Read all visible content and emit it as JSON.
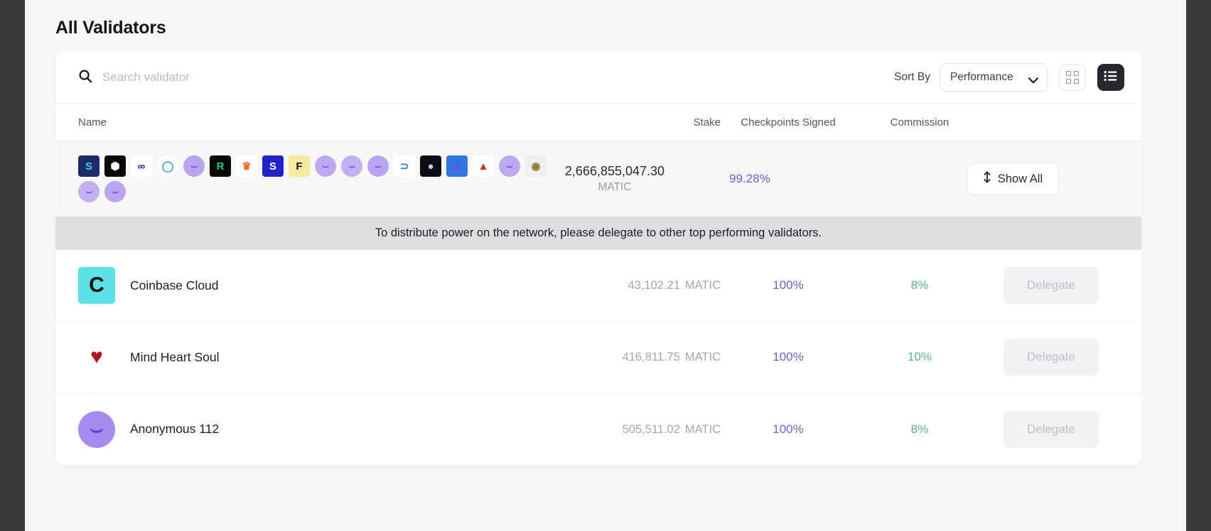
{
  "page": {
    "title": "All Validators"
  },
  "toolbar": {
    "search_placeholder": "Search validator",
    "search_value": "",
    "sort_label": "Sort By",
    "sort_value": "Performance",
    "sort_options": [
      "Performance"
    ],
    "grid_view_label": "Grid view",
    "list_view_label": "List view"
  },
  "table": {
    "headers": {
      "name": "Name",
      "stake": "Stake",
      "checkpoints": "Checkpoints Signed",
      "commission": "Commission"
    }
  },
  "aggregate": {
    "stake": "2,666,855,047.30",
    "stake_unit": "MATIC",
    "checkpoints": "99.28%",
    "show_all_label": "Show All",
    "avatars": [
      {
        "name": "sperax-avatar",
        "bg": "#1d2b6b",
        "fg": "#3fd6e8",
        "glyph": "S"
      },
      {
        "name": "hexagon-avatar",
        "bg": "#0a0a0a",
        "fg": "#ffffff",
        "glyph": "⬢"
      },
      {
        "name": "infinity-avatar",
        "bg": "#ffffff",
        "fg": "#1f2f8a",
        "glyph": "∞"
      },
      {
        "name": "circle-avatar",
        "bg": "#ffffff",
        "fg": "#3d9fe0",
        "glyph": "◯"
      },
      {
        "name": "anonymous-face-avatar",
        "bg": "#b9a4ef",
        "fg": "#7a4fd4",
        "glyph": "⌣"
      },
      {
        "name": "matrix-r-avatar",
        "bg": "#060606",
        "fg": "#21d17a",
        "glyph": "R"
      },
      {
        "name": "crown-avatar",
        "bg": "#ffffff",
        "fg": "#f0682a",
        "glyph": "♛"
      },
      {
        "name": "sphere-s-avatar",
        "bg": "#2222c7",
        "fg": "#ffffff",
        "glyph": "S"
      },
      {
        "name": "letter-f-avatar",
        "bg": "#f7e9a0",
        "fg": "#1a1a1a",
        "glyph": "F"
      },
      {
        "name": "anonymous-face-avatar",
        "bg": "#bda9f0",
        "fg": "#7a4fd4",
        "glyph": "⌣"
      },
      {
        "name": "anonymous-face-avatar",
        "bg": "#c1b0f2",
        "fg": "#7a4fd4",
        "glyph": "⌣"
      },
      {
        "name": "anonymous-face-avatar",
        "bg": "#b9a4ef",
        "fg": "#7a4fd4",
        "glyph": "⌣"
      },
      {
        "name": "bracket-avatar",
        "bg": "#ffffff",
        "fg": "#2e7fd4",
        "glyph": "⊃"
      },
      {
        "name": "globe-avatar",
        "bg": "#0d0d18",
        "fg": "#c9c9d8",
        "glyph": "●"
      },
      {
        "name": "avalanche-avatar",
        "bg": "#2f74e0",
        "fg": "#7e3ff2",
        "glyph": "▲"
      },
      {
        "name": "mountain-avatar",
        "bg": "#ffffff",
        "fg": "#e0252c",
        "glyph": "▲"
      },
      {
        "name": "anonymous-face-avatar",
        "bg": "#bda9f0",
        "fg": "#7a4fd4",
        "glyph": "⌣"
      },
      {
        "name": "portrait-avatar",
        "bg": "#f0f0f0",
        "fg": "#8a7a3a",
        "glyph": "◉"
      },
      {
        "name": "anonymous-face-avatar",
        "bg": "#c2b1f2",
        "fg": "#7a4fd4",
        "glyph": "⌣"
      },
      {
        "name": "anonymous-face-avatar",
        "bg": "#b9a4ef",
        "fg": "#7a4fd4",
        "glyph": "⌣"
      }
    ]
  },
  "banner": {
    "text": "To distribute power on the network, please delegate to other top performing validators."
  },
  "validators": [
    {
      "name": "Coinbase Cloud",
      "stake": "43,102.21",
      "stake_unit": "MATIC",
      "checkpoints": "100%",
      "commission": "8%",
      "action_label": "Delegate",
      "logo": {
        "name": "coinbase-logo",
        "bg": "#5ce1e6",
        "fg": "#0a0a0a",
        "glyph": "C",
        "shape": "square"
      }
    },
    {
      "name": "Mind Heart Soul",
      "stake": "416,811.75",
      "stake_unit": "MATIC",
      "checkpoints": "100%",
      "commission": "10%",
      "action_label": "Delegate",
      "logo": {
        "name": "heart-rays-logo",
        "bg": "#ffffff",
        "fg": "#b4122b",
        "glyph": "♥",
        "shape": "square"
      }
    },
    {
      "name": "Anonymous 112",
      "stake": "505,511.02",
      "stake_unit": "MATIC",
      "checkpoints": "100%",
      "commission": "8%",
      "action_label": "Delegate",
      "logo": {
        "name": "anonymous-face-logo",
        "bg": "#a78bf0",
        "fg": "#6d3fd1",
        "glyph": "⌣",
        "shape": "round"
      }
    }
  ],
  "colors": {
    "accent_purple": "#6f5fd1",
    "accent_green": "#58b09c",
    "page_bg": "#f6f6f6",
    "banner_bg": "#dedee0"
  }
}
